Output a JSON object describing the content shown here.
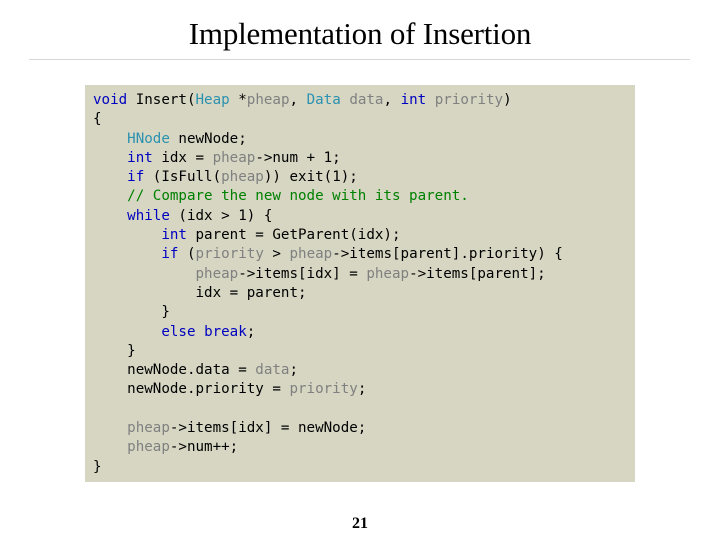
{
  "slide": {
    "title": "Implementation of Insertion",
    "page_number": "21"
  },
  "colors": {
    "code_background": "#d6d6c3",
    "keyword": "#0000c0",
    "type": "#2b91af",
    "parameter": "#808080",
    "comment": "#008000",
    "plain": "#000000"
  },
  "code": {
    "language": "C",
    "lines": [
      [
        {
          "t": "kw",
          "v": "void"
        },
        {
          "t": "plain",
          "v": " Insert("
        },
        {
          "t": "type",
          "v": "Heap"
        },
        {
          "t": "plain",
          "v": " *"
        },
        {
          "t": "param",
          "v": "pheap"
        },
        {
          "t": "plain",
          "v": ", "
        },
        {
          "t": "type",
          "v": "Data"
        },
        {
          "t": "plain",
          "v": " "
        },
        {
          "t": "param",
          "v": "data"
        },
        {
          "t": "plain",
          "v": ", "
        },
        {
          "t": "kw",
          "v": "int"
        },
        {
          "t": "plain",
          "v": " "
        },
        {
          "t": "param",
          "v": "priority"
        },
        {
          "t": "plain",
          "v": ")"
        }
      ],
      [
        {
          "t": "plain",
          "v": "{"
        }
      ],
      [
        {
          "t": "plain",
          "v": "    "
        },
        {
          "t": "type",
          "v": "HNode"
        },
        {
          "t": "plain",
          "v": " newNode;"
        }
      ],
      [
        {
          "t": "plain",
          "v": "    "
        },
        {
          "t": "kw",
          "v": "int"
        },
        {
          "t": "plain",
          "v": " idx = "
        },
        {
          "t": "param",
          "v": "pheap"
        },
        {
          "t": "plain",
          "v": "->num + 1;"
        }
      ],
      [
        {
          "t": "plain",
          "v": "    "
        },
        {
          "t": "kw",
          "v": "if"
        },
        {
          "t": "plain",
          "v": " (IsFull("
        },
        {
          "t": "param",
          "v": "pheap"
        },
        {
          "t": "plain",
          "v": ")) exit(1);"
        }
      ],
      [
        {
          "t": "plain",
          "v": "    "
        },
        {
          "t": "comment",
          "v": "// Compare the new node with its parent."
        }
      ],
      [
        {
          "t": "plain",
          "v": "    "
        },
        {
          "t": "kw",
          "v": "while"
        },
        {
          "t": "plain",
          "v": " (idx > 1) {"
        }
      ],
      [
        {
          "t": "plain",
          "v": "        "
        },
        {
          "t": "kw",
          "v": "int"
        },
        {
          "t": "plain",
          "v": " parent = GetParent(idx);"
        }
      ],
      [
        {
          "t": "plain",
          "v": "        "
        },
        {
          "t": "kw",
          "v": "if"
        },
        {
          "t": "plain",
          "v": " ("
        },
        {
          "t": "param",
          "v": "priority"
        },
        {
          "t": "plain",
          "v": " > "
        },
        {
          "t": "param",
          "v": "pheap"
        },
        {
          "t": "plain",
          "v": "->items[parent].priority) {"
        }
      ],
      [
        {
          "t": "plain",
          "v": "            "
        },
        {
          "t": "param",
          "v": "pheap"
        },
        {
          "t": "plain",
          "v": "->items[idx] = "
        },
        {
          "t": "param",
          "v": "pheap"
        },
        {
          "t": "plain",
          "v": "->items[parent];"
        }
      ],
      [
        {
          "t": "plain",
          "v": "            idx = parent;"
        }
      ],
      [
        {
          "t": "plain",
          "v": "        }"
        }
      ],
      [
        {
          "t": "plain",
          "v": "        "
        },
        {
          "t": "kw",
          "v": "else"
        },
        {
          "t": "plain",
          "v": " "
        },
        {
          "t": "kw",
          "v": "break"
        },
        {
          "t": "plain",
          "v": ";"
        }
      ],
      [
        {
          "t": "plain",
          "v": "    }"
        }
      ],
      [
        {
          "t": "plain",
          "v": "    newNode.data = "
        },
        {
          "t": "param",
          "v": "data"
        },
        {
          "t": "plain",
          "v": ";"
        }
      ],
      [
        {
          "t": "plain",
          "v": "    newNode.priority = "
        },
        {
          "t": "param",
          "v": "priority"
        },
        {
          "t": "plain",
          "v": ";"
        }
      ],
      [
        {
          "t": "plain",
          "v": ""
        }
      ],
      [
        {
          "t": "plain",
          "v": "    "
        },
        {
          "t": "param",
          "v": "pheap"
        },
        {
          "t": "plain",
          "v": "->items[idx] = newNode;"
        }
      ],
      [
        {
          "t": "plain",
          "v": "    "
        },
        {
          "t": "param",
          "v": "pheap"
        },
        {
          "t": "plain",
          "v": "->num++;"
        }
      ],
      [
        {
          "t": "plain",
          "v": "}"
        }
      ]
    ]
  }
}
